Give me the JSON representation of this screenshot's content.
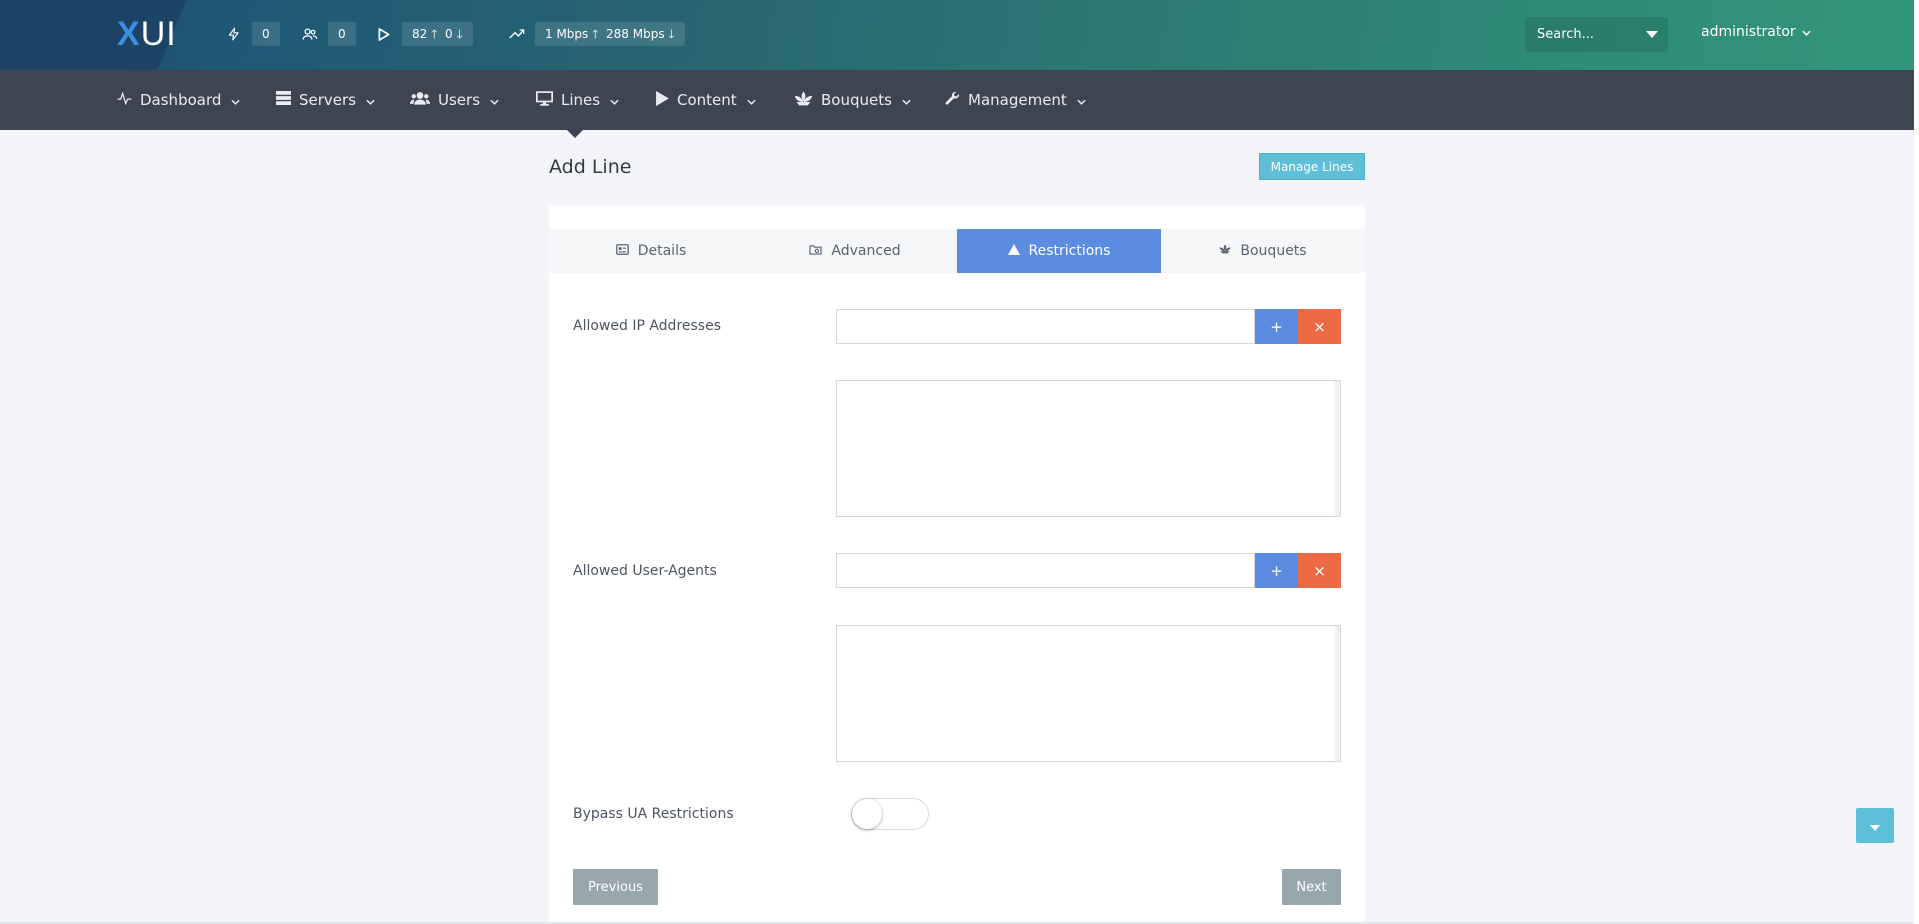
{
  "app": {
    "logo_x": "X",
    "logo_ui": "UI",
    "brand_colors": {
      "topbar_start": "#1e4a6c",
      "topbar_end": "#33967a",
      "navbar": "#3e4551",
      "primary": "#5b8ce2",
      "danger": "#ec6b45",
      "info": "#5fbfd8",
      "secondary": "#98a6ad"
    }
  },
  "header": {
    "stats": [
      {
        "icon": "bolt-icon",
        "value": "0"
      },
      {
        "icon": "users-icon",
        "value": "0"
      },
      {
        "icon": "play-icon",
        "value_up": "82",
        "value_down": "0"
      },
      {
        "icon": "trend-up-icon",
        "value_up": "1 Mbps",
        "value_down": "288 Mbps"
      }
    ],
    "search_placeholder": "Search...",
    "user_name": "administrator"
  },
  "nav": {
    "items": [
      {
        "label": "Dashboard",
        "icon": "activity-icon"
      },
      {
        "label": "Servers",
        "icon": "server-icon"
      },
      {
        "label": "Users",
        "icon": "users-group-icon"
      },
      {
        "label": "Lines",
        "icon": "monitor-icon"
      },
      {
        "label": "Content",
        "icon": "play-icon"
      },
      {
        "label": "Bouquets",
        "icon": "flower-icon"
      },
      {
        "label": "Management",
        "icon": "wrench-icon"
      }
    ],
    "active": "Lines"
  },
  "page": {
    "title": "Add Line",
    "manage_button": "Manage Lines"
  },
  "tabs": [
    {
      "label": "Details",
      "icon": "id-card-icon",
      "active": false
    },
    {
      "label": "Advanced",
      "icon": "folder-cog-icon",
      "active": false
    },
    {
      "label": "Restrictions",
      "icon": "triangle-icon",
      "active": true
    },
    {
      "label": "Bouquets",
      "icon": "flower-icon",
      "active": false
    }
  ],
  "form": {
    "allowed_ip_label": "Allowed IP Addresses",
    "allowed_ip_value": "",
    "allowed_ua_label": "Allowed User-Agents",
    "allowed_ua_value": "",
    "add_symbol": "+",
    "remove_symbol": "×",
    "bypass_label": "Bypass UA Restrictions",
    "bypass_enabled": false
  },
  "footer_buttons": {
    "previous": "Previous",
    "next": "Next"
  }
}
